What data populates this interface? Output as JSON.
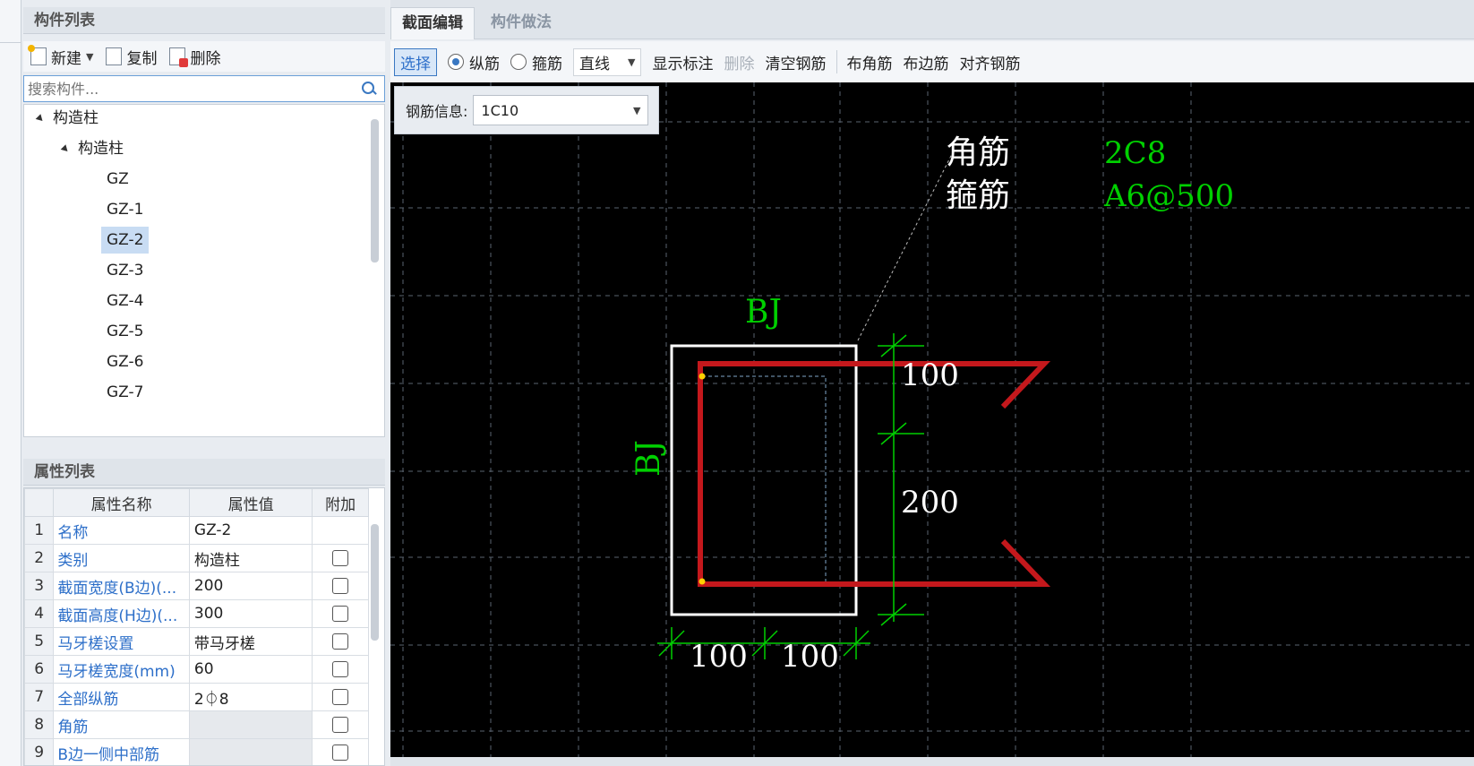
{
  "component_list": {
    "title": "构件列表",
    "toolbar": {
      "new_label": "新建",
      "copy_label": "复制",
      "delete_label": "删除"
    },
    "search_placeholder": "搜索构件...",
    "tree": {
      "root": "构造柱",
      "group": "构造柱",
      "items": [
        "GZ",
        "GZ-1",
        "GZ-2",
        "GZ-3",
        "GZ-4",
        "GZ-5",
        "GZ-6",
        "GZ-7"
      ],
      "selected": "GZ-2"
    }
  },
  "property_list": {
    "title": "属性列表",
    "headers": {
      "name": "属性名称",
      "value": "属性值",
      "extra": "附加"
    },
    "rows": [
      {
        "idx": "1",
        "name": "名称",
        "value": "GZ-2",
        "has_check": false
      },
      {
        "idx": "2",
        "name": "类别",
        "value": "构造柱",
        "has_check": true
      },
      {
        "idx": "3",
        "name": "截面宽度(B边)(...",
        "value": "200",
        "has_check": true
      },
      {
        "idx": "4",
        "name": "截面高度(H边)(...",
        "value": "300",
        "has_check": true
      },
      {
        "idx": "5",
        "name": "马牙槎设置",
        "value": "带马牙槎",
        "has_check": true
      },
      {
        "idx": "6",
        "name": "马牙槎宽度(mm)",
        "value": "60",
        "has_check": true
      },
      {
        "idx": "7",
        "name": "全部纵筋",
        "value": "2⏀8",
        "has_check": true
      },
      {
        "idx": "8",
        "name": "角筋",
        "value": "",
        "has_check": true
      },
      {
        "idx": "9",
        "name": "B边一侧中部筋",
        "value": "",
        "has_check": true
      }
    ]
  },
  "editor": {
    "tabs": [
      "截面编辑",
      "构件做法"
    ],
    "active_tab": "截面编辑",
    "toolbar": {
      "select": "选择",
      "longitudinal": "纵筋",
      "stirrup": "箍筋",
      "line_type": "直线",
      "show_dims": "显示标注",
      "delete": "删除",
      "clear_rebar": "清空钢筋",
      "corner_rebar": "布角筋",
      "edge_rebar": "布边筋",
      "align_rebar": "对齐钢筋"
    },
    "rebar_info": {
      "label": "钢筋信息:",
      "value": "1C10"
    }
  },
  "drawing": {
    "legend": [
      {
        "name": "角筋",
        "value": "2C8"
      },
      {
        "name": "箍筋",
        "value": "A6@500"
      }
    ],
    "edge_label_top": "BJ",
    "edge_label_left": "BJ",
    "dim_right_top": "100",
    "dim_right_bottom": "200",
    "dim_bottom_left": "100",
    "dim_bottom_right": "100",
    "colors": {
      "green": "#00d000",
      "red": "#c4181c",
      "white": "#ffffff",
      "grid": "#5a6470"
    }
  }
}
